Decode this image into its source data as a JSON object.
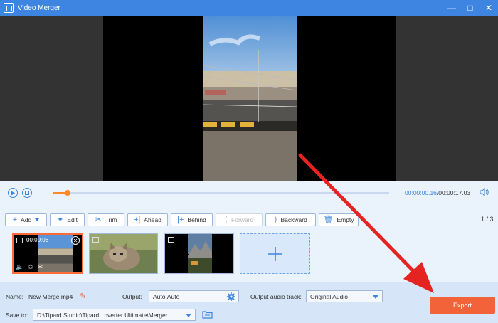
{
  "window": {
    "title": "Video Merger",
    "controls": [
      "minimize",
      "maximize",
      "close"
    ]
  },
  "player": {
    "current_time": "00:00:00.16",
    "total_time": "/00:00:17.03",
    "progress": 0.042
  },
  "toolbar": {
    "add": "Add",
    "edit": "Edit",
    "trim": "Trim",
    "ahead": "Ahead",
    "behind": "Behind",
    "forward": "Forward",
    "backward": "Backward",
    "empty": "Empty",
    "page": "1 / 3"
  },
  "clips": [
    {
      "duration": "00:00:06",
      "selected": true
    },
    {
      "duration": "",
      "selected": false
    },
    {
      "duration": "",
      "selected": false
    }
  ],
  "output": {
    "name_label": "Name:",
    "name_value": "New Merge.mp4",
    "output_label": "Output:",
    "output_value": "Auto;Auto",
    "audio_label": "Output audio track:",
    "audio_value": "Original Audio",
    "save_label": "Save to:",
    "save_path": "D:\\Tipard Studio\\Tipard...nverter Ultimate\\Merger",
    "export": "Export"
  },
  "colors": {
    "accent": "#3d85e0",
    "export": "#f2633a",
    "progress": "#ff8a2a",
    "arrow": "#e52421"
  }
}
